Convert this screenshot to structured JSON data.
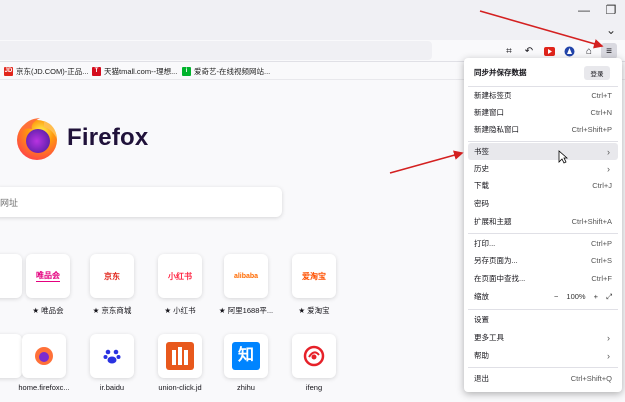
{
  "window": {
    "minimize_icon": "minimize-icon",
    "restore_icon": "restore-icon",
    "list_tabs_icon": "chevron-down-icon"
  },
  "toolbar": {
    "icons": [
      "screenshot-icon",
      "back-arrow-icon",
      "video-icon",
      "vpn-icon",
      "extensions-icon",
      "menu-icon"
    ]
  },
  "bookmarks": [
    {
      "label": "京东(JD.COM)-正品...",
      "badge": "JD",
      "color": "#e1251b"
    },
    {
      "label": "天猫tmall.com--理想...",
      "badge": "T",
      "color": "#d40c1d"
    },
    {
      "label": "爱奇艺-在线视频网站...",
      "badge": "i",
      "color": "#00b32c"
    }
  ],
  "home": {
    "brand": "Firefox",
    "search_placeholder": "网址",
    "top_sites_row1": [
      {
        "label": "",
        "logo": "",
        "color": "#ffffff"
      },
      {
        "label": "唯品会",
        "logo": "唯品会",
        "color": "#e4007f"
      },
      {
        "label": "京东商城",
        "logo": "京东",
        "color": "#e1251b"
      },
      {
        "label": "小红书",
        "logo": "小红书",
        "color": "#ff2442"
      },
      {
        "label": "阿里1688平...",
        "logo": "alibaba",
        "color": "#ff6a00"
      },
      {
        "label": "爱淘宝",
        "logo": "爱淘宝",
        "color": "#ff5000"
      }
    ],
    "top_sites_row2": [
      {
        "label": "",
        "logo": "",
        "color": "#ffffff"
      },
      {
        "label": "home.firefoxc...",
        "logo": "firefox",
        "color": "#ff7139"
      },
      {
        "label": "ir.baidu",
        "logo": "paw",
        "color": "#2932e1"
      },
      {
        "label": "union-click.jd",
        "logo": "m",
        "color": "#e8581c"
      },
      {
        "label": "zhihu",
        "logo": "知",
        "color": "#0084ff"
      },
      {
        "label": "ifeng",
        "logo": "ifeng",
        "color": "#e62129"
      }
    ],
    "pin_glyph": "★"
  },
  "menu": {
    "sync_label": "同步并保存数据",
    "login_label": "登录",
    "items": [
      {
        "label": "新建标签页",
        "shortcut": "Ctrl+T"
      },
      {
        "label": "新建窗口",
        "shortcut": "Ctrl+N"
      },
      {
        "label": "新建隐私窗口",
        "shortcut": "Ctrl+Shift+P"
      },
      {
        "label": "书签",
        "shortcut": "",
        "arrow": "›"
      },
      {
        "label": "历史",
        "shortcut": "",
        "arrow": "›"
      },
      {
        "label": "下载",
        "shortcut": "Ctrl+J"
      },
      {
        "label": "密码",
        "shortcut": ""
      },
      {
        "label": "扩展和主题",
        "shortcut": "Ctrl+Shift+A"
      },
      {
        "label": "打印...",
        "shortcut": "Ctrl+P"
      },
      {
        "label": "另存页面为...",
        "shortcut": "Ctrl+S"
      },
      {
        "label": "在页面中查找...",
        "shortcut": "Ctrl+F"
      },
      {
        "label": "缩放",
        "shortcut": ""
      },
      {
        "label": "设置",
        "shortcut": ""
      },
      {
        "label": "更多工具",
        "shortcut": "",
        "arrow": "›"
      },
      {
        "label": "帮助",
        "shortcut": "",
        "arrow": "›"
      },
      {
        "label": "退出",
        "shortcut": "Ctrl+Shift+Q"
      }
    ],
    "zoom": {
      "minus": "−",
      "value": "100%",
      "plus": "+",
      "fullscreen": "⤢"
    }
  },
  "annotation_color": "#d42020"
}
